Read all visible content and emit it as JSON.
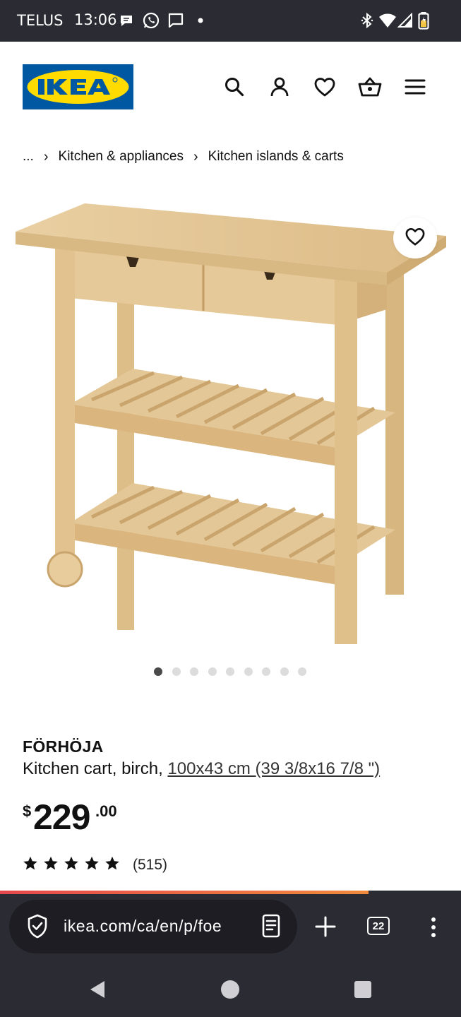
{
  "status_bar": {
    "carrier": "TELUS",
    "time": "13:06",
    "left_icons": [
      "chat-bubble-icon",
      "whatsapp-icon",
      "message-icon",
      "dot-icon"
    ],
    "right_icons": [
      "bluetooth-icon",
      "wifi-icon",
      "signal-icon",
      "battery-icon"
    ]
  },
  "header": {
    "logo_text": "IKEA",
    "logo_colors": {
      "background": "#0058a3",
      "oval": "#ffdb00",
      "text": "#0058a3"
    },
    "icons": [
      "search-icon",
      "account-icon",
      "wishlist-heart-icon",
      "shopping-bag-icon",
      "menu-icon"
    ]
  },
  "breadcrumb": {
    "ellipsis": "...",
    "separator": "›",
    "items": [
      "Kitchen & appliances",
      "Kitchen islands & carts"
    ]
  },
  "product_image": {
    "description_icon": "wooden-kitchen-cart-image",
    "favorite_icon": "heart-icon"
  },
  "carousel": {
    "total_dots": 9,
    "active_index": 0
  },
  "product": {
    "name": "FÖRHÖJA",
    "description": "Kitchen cart, birch, ",
    "size_link": "100x43 cm (39 3/8x16 7/8 \")",
    "price": {
      "currency": "$",
      "main": "229",
      "cents": ".00"
    },
    "rating": {
      "stars": 5,
      "count": "(515)"
    }
  },
  "browser": {
    "url": "ikea.com/ca/en/p/foe",
    "tab_count": "22",
    "load_progress": 0.8,
    "accent_colors": [
      "#e5484d",
      "#f08a3c"
    ],
    "icons": [
      "shield-check-icon",
      "reader-mode-icon",
      "new-tab-plus-icon",
      "tabs-icon",
      "more-vertical-icon"
    ]
  },
  "system_nav": {
    "icons": [
      "back-icon",
      "home-icon",
      "recents-icon"
    ]
  }
}
